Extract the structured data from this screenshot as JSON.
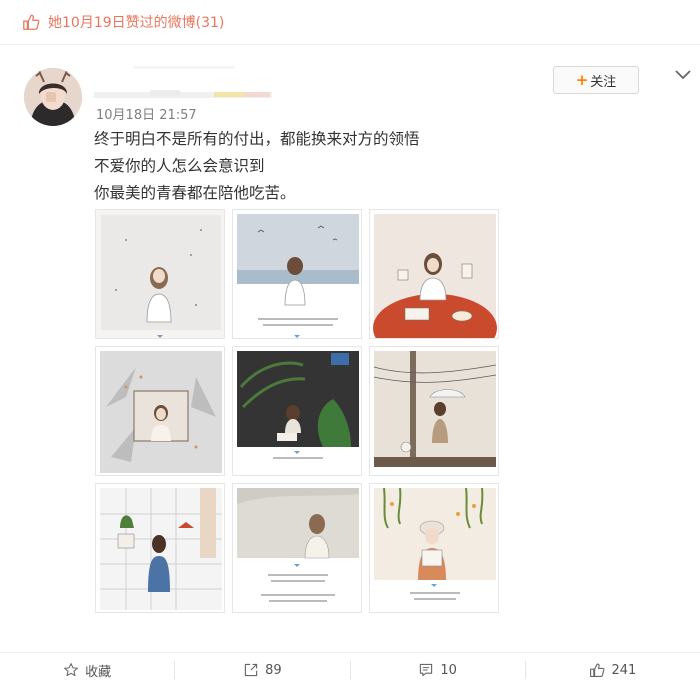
{
  "header": {
    "title": "她10月19日赞过的微博(31)"
  },
  "post": {
    "time": "10月18日 21:57",
    "follow_label": "关注",
    "follow_plus": "+",
    "lines": [
      "终于明白不是所有的付出，都能换来对方的领悟",
      "不爱你的人怎么会意识到",
      "你最美的青春都在陪他吃苦。"
    ]
  },
  "actions": {
    "favorite": "收藏",
    "repost": "89",
    "comment": "10",
    "like": "241"
  },
  "icons": [
    "thumb-up-icon",
    "chevron-down-icon",
    "star-icon",
    "share-icon",
    "comment-icon"
  ],
  "colors": {
    "accent": "#e8765e",
    "follow_plus": "#ff8200"
  }
}
